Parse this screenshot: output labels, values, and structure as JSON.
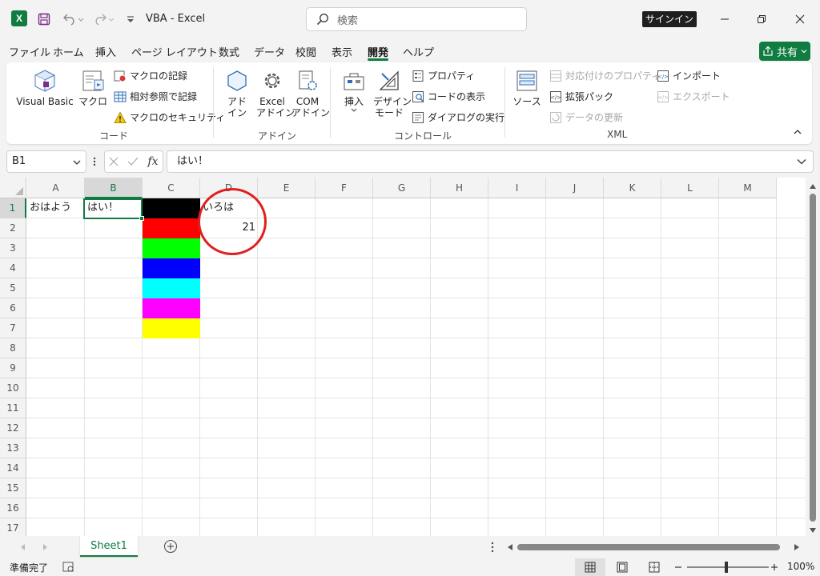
{
  "app": {
    "logo": "X",
    "title": "VBA  -  Excel"
  },
  "search": {
    "placeholder": "検索"
  },
  "account": {
    "signin": "サインイン"
  },
  "menu": {
    "tabs": [
      "ファイル",
      "ホーム",
      "挿入",
      "ページ レイアウト",
      "数式",
      "データ",
      "校閲",
      "表示",
      "開発",
      "ヘルプ"
    ],
    "active": "開発",
    "share": "共有"
  },
  "ribbon": {
    "code": {
      "label": "コード",
      "visual_basic": "Visual Basic",
      "macro": "マクロ",
      "record": "マクロの記録",
      "relative": "相対参照で記録",
      "security": "マクロのセキュリティ"
    },
    "addin": {
      "label": "アドイン",
      "addin_l1": "アド",
      "addin_l2": "イン",
      "excel_l1": "Excel",
      "excel_l2": "アドイン",
      "com_l1": "COM",
      "com_l2": "アドイン"
    },
    "controls": {
      "label": "コントロール",
      "insert": "挿入",
      "design_l1": "デザイン",
      "design_l2": "モード",
      "properties": "プロパティ",
      "view_code": "コードの表示",
      "run_dialog": "ダイアログの実行"
    },
    "xml": {
      "label": "XML",
      "source": "ソース",
      "map_props": "対応付けのプロパティ",
      "expansion": "拡張パック",
      "refresh": "データの更新",
      "import": "インポート",
      "export": "エクスポート"
    }
  },
  "formula_bar": {
    "name_box": "B1",
    "fx": "fx",
    "value": "はい！"
  },
  "grid": {
    "columns": [
      "A",
      "B",
      "C",
      "D",
      "E",
      "F",
      "G",
      "H",
      "I",
      "J",
      "K",
      "L",
      "M"
    ],
    "rows": [
      "1",
      "2",
      "3",
      "4",
      "5",
      "6",
      "7",
      "8",
      "9",
      "10",
      "11",
      "12",
      "13",
      "14",
      "15",
      "16",
      "17"
    ],
    "cells": {
      "A1": "おはよう",
      "B1": "はい！",
      "D1": "いろは",
      "D2": "21"
    },
    "c_fill_colors": [
      "#000000",
      "#ff0000",
      "#00ff00",
      "#0000ff",
      "#00ffff",
      "#ff00ff",
      "#ffff00"
    ]
  },
  "sheets": {
    "tabs": [
      "Sheet1"
    ],
    "active": "Sheet1"
  },
  "status": {
    "ready": "準備完了",
    "zoom": "100%"
  }
}
